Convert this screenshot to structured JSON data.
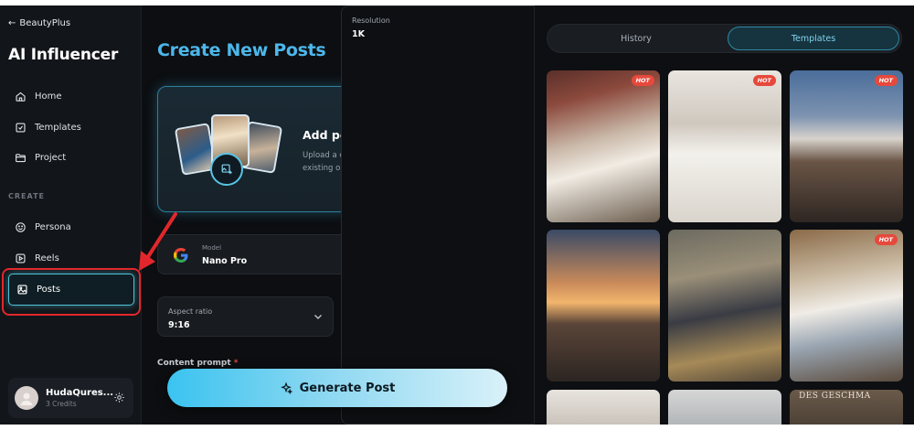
{
  "sidebar": {
    "back_label": "BeautyPlus",
    "app_title": "AI Influencer",
    "nav": [
      {
        "label": "Home",
        "icon": "home-icon"
      },
      {
        "label": "Templates",
        "icon": "templates-icon"
      },
      {
        "label": "Project",
        "icon": "folder-icon"
      }
    ],
    "section_create": "CREATE",
    "create_nav": [
      {
        "label": "Persona",
        "icon": "smile-icon"
      },
      {
        "label": "Reels",
        "icon": "play-icon"
      },
      {
        "label": "Posts",
        "icon": "image-icon",
        "active": true
      }
    ],
    "user": {
      "name": "HudaQures...",
      "credits": "3 Credits"
    }
  },
  "main": {
    "title": "Create New Posts",
    "persona": {
      "title": "Add persona",
      "required_mark": "*",
      "description": "Upload a custom persona photo or select an existing one."
    },
    "model": {
      "label": "Model",
      "value": "Nano Pro"
    },
    "aspect_ratio": {
      "label": "Aspect ratio",
      "value": "9:16"
    },
    "resolution": {
      "label": "Resolution",
      "value": "1K"
    },
    "prompt": {
      "label": "Content prompt",
      "required_mark": "*"
    },
    "generate_label": "Generate Post"
  },
  "right": {
    "tabs": [
      {
        "label": "History",
        "active": false
      },
      {
        "label": "Templates",
        "active": true
      }
    ],
    "hot_badge": "HOT",
    "bottom_sign": "DES GESCHMA"
  },
  "colors": {
    "accent": "#4cb7ea",
    "active_border": "#4fc3d9",
    "highlight_red": "#e2272c",
    "hot": "#e6493c"
  }
}
